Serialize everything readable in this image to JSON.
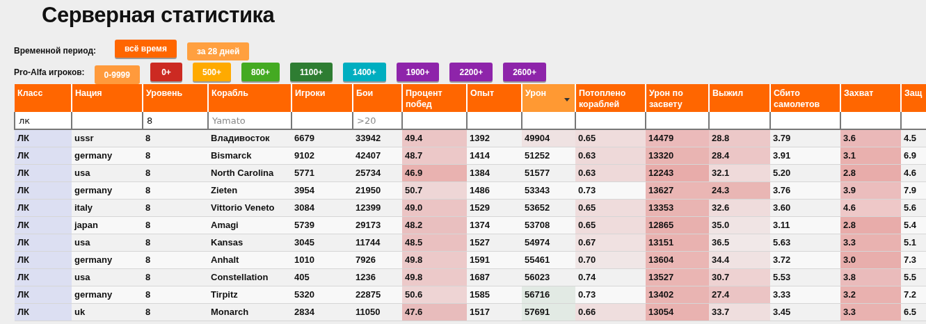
{
  "title": "Серверная статистика",
  "period": {
    "label": "Временной период:",
    "buttons": [
      {
        "label": "всё время",
        "selected": false,
        "color": "#ff6600"
      },
      {
        "label": "за 28 дней",
        "selected": true,
        "color": "#ffa040"
      }
    ]
  },
  "pro_alfa": {
    "label": "Pro-Alfa игроков:",
    "buttons": [
      {
        "label": "0-9999",
        "selected": true,
        "color": "#ff9a3c"
      },
      {
        "label": "0+",
        "selected": false,
        "color": "#cc2a22"
      },
      {
        "label": "500+",
        "selected": false,
        "color": "#ffaa00"
      },
      {
        "label": "800+",
        "selected": false,
        "color": "#44aa22"
      },
      {
        "label": "1100+",
        "selected": false,
        "color": "#2e7d32"
      },
      {
        "label": "1400+",
        "selected": false,
        "color": "#00aec0"
      },
      {
        "label": "1900+",
        "selected": false,
        "color": "#8e24aa"
      },
      {
        "label": "2200+",
        "selected": false,
        "color": "#8e24aa"
      },
      {
        "label": "2600+",
        "selected": false,
        "color": "#8e24aa"
      }
    ]
  },
  "table": {
    "columns": [
      {
        "label": "Класс",
        "sorted": false,
        "filter": {
          "value": "лк"
        }
      },
      {
        "label": "Нация",
        "sorted": false
      },
      {
        "label": "Уровень",
        "sorted": false,
        "filter": {
          "value": "8"
        }
      },
      {
        "label": "Корабль",
        "sorted": false,
        "filter": {
          "placeholder": "Yamato"
        }
      },
      {
        "label": "Игроки",
        "sorted": false
      },
      {
        "label": "Бои",
        "sorted": false,
        "filter": {
          "placeholder": ">20"
        }
      },
      {
        "label": "Процент побед",
        "sorted": false
      },
      {
        "label": "Опыт",
        "sorted": false
      },
      {
        "label": "Урон",
        "sorted": true
      },
      {
        "label": "Потоплено кораблей",
        "sorted": false
      },
      {
        "label": "Урон по засвету",
        "sorted": false
      },
      {
        "label": "Выжил",
        "sorted": false
      },
      {
        "label": "Сбито самолетов",
        "sorted": false
      },
      {
        "label": "Захват",
        "sorted": false
      },
      {
        "label": "Защ",
        "sorted": false
      }
    ],
    "rows": [
      {
        "cells": [
          {
            "text": "ЛК"
          },
          {
            "text": "ussr"
          },
          {
            "text": "8"
          },
          {
            "text": "Владивосток"
          },
          {
            "text": "6679"
          },
          {
            "text": "33942"
          },
          {
            "text": "49.4",
            "color": "#ebc5c5"
          },
          {
            "text": "1392"
          },
          {
            "text": "49904",
            "color": "#efe2e2"
          },
          {
            "text": "0.65",
            "color": "#efdcdc"
          },
          {
            "text": "14479",
            "color": "#ebbaba"
          },
          {
            "text": "28.8",
            "color": "#ecc8c8"
          },
          {
            "text": "3.79"
          },
          {
            "text": "3.6",
            "color": "#eab8b8"
          },
          {
            "text": "4.5"
          }
        ]
      },
      {
        "cells": [
          {
            "text": "ЛК"
          },
          {
            "text": "germany"
          },
          {
            "text": "8"
          },
          {
            "text": "Bismarck"
          },
          {
            "text": "9102"
          },
          {
            "text": "42407"
          },
          {
            "text": "48.7",
            "color": "#ecc8c8"
          },
          {
            "text": "1414"
          },
          {
            "text": "51252"
          },
          {
            "text": "0.63",
            "color": "#eed9d9"
          },
          {
            "text": "13320",
            "color": "#e9b4b2"
          },
          {
            "text": "28.4",
            "color": "#ecc6c6"
          },
          {
            "text": "3.91"
          },
          {
            "text": "3.1",
            "color": "#e9b0ae"
          },
          {
            "text": "6.9"
          }
        ]
      },
      {
        "cells": [
          {
            "text": "ЛК"
          },
          {
            "text": "usa"
          },
          {
            "text": "8"
          },
          {
            "text": "North Carolina"
          },
          {
            "text": "5771"
          },
          {
            "text": "25734"
          },
          {
            "text": "46.9",
            "color": "#e9b2b0"
          },
          {
            "text": "1384"
          },
          {
            "text": "51577"
          },
          {
            "text": "0.63",
            "color": "#eed9d9"
          },
          {
            "text": "12243",
            "color": "#e8acaa"
          },
          {
            "text": "32.1",
            "color": "#efdada"
          },
          {
            "text": "5.20"
          },
          {
            "text": "2.8",
            "color": "#e8acaa"
          },
          {
            "text": "4.6"
          }
        ]
      },
      {
        "cells": [
          {
            "text": "ЛК"
          },
          {
            "text": "germany"
          },
          {
            "text": "8"
          },
          {
            "text": "Zieten"
          },
          {
            "text": "3954"
          },
          {
            "text": "21950"
          },
          {
            "text": "50.7",
            "color": "#eed6d6"
          },
          {
            "text": "1486"
          },
          {
            "text": "53343"
          },
          {
            "text": "0.73"
          },
          {
            "text": "13627",
            "color": "#eab6b4"
          },
          {
            "text": "24.3",
            "color": "#e9b6b4"
          },
          {
            "text": "3.76"
          },
          {
            "text": "3.9",
            "color": "#ebbdbd"
          },
          {
            "text": "7.9"
          }
        ]
      },
      {
        "cells": [
          {
            "text": "ЛК"
          },
          {
            "text": "italy"
          },
          {
            "text": "8"
          },
          {
            "text": "Vittorio Veneto"
          },
          {
            "text": "3084"
          },
          {
            "text": "12399"
          },
          {
            "text": "49.0",
            "color": "#ebc4c4"
          },
          {
            "text": "1529"
          },
          {
            "text": "53652"
          },
          {
            "text": "0.65",
            "color": "#efdcdc"
          },
          {
            "text": "13353",
            "color": "#e9b4b2"
          },
          {
            "text": "32.6",
            "color": "#efdcdc"
          },
          {
            "text": "3.60"
          },
          {
            "text": "4.6",
            "color": "#eec8c8"
          },
          {
            "text": "5.6"
          }
        ]
      },
      {
        "cells": [
          {
            "text": "ЛК"
          },
          {
            "text": "japan"
          },
          {
            "text": "8"
          },
          {
            "text": "Amagi"
          },
          {
            "text": "5739"
          },
          {
            "text": "29173"
          },
          {
            "text": "48.2",
            "color": "#e9bfbf"
          },
          {
            "text": "1374"
          },
          {
            "text": "53708"
          },
          {
            "text": "0.65",
            "color": "#efdcdc"
          },
          {
            "text": "12865",
            "color": "#e8b0ae"
          },
          {
            "text": "35.0",
            "color": "#f0e4e4"
          },
          {
            "text": "3.11"
          },
          {
            "text": "2.8",
            "color": "#e8acaa"
          },
          {
            "text": "5.4"
          }
        ]
      },
      {
        "cells": [
          {
            "text": "ЛК"
          },
          {
            "text": "usa"
          },
          {
            "text": "8"
          },
          {
            "text": "Kansas"
          },
          {
            "text": "3045"
          },
          {
            "text": "11744"
          },
          {
            "text": "48.5",
            "color": "#eac0c0"
          },
          {
            "text": "1527"
          },
          {
            "text": "54974"
          },
          {
            "text": "0.67",
            "color": "#f0e1e1"
          },
          {
            "text": "13151",
            "color": "#e9b2b0"
          },
          {
            "text": "36.5",
            "color": "#f1e8e8"
          },
          {
            "text": "5.63"
          },
          {
            "text": "3.3",
            "color": "#e9b2b0"
          },
          {
            "text": "5.1"
          }
        ]
      },
      {
        "cells": [
          {
            "text": "ЛК"
          },
          {
            "text": "germany"
          },
          {
            "text": "8"
          },
          {
            "text": "Anhalt"
          },
          {
            "text": "1010"
          },
          {
            "text": "7926"
          },
          {
            "text": "49.8",
            "color": "#ecc9c9"
          },
          {
            "text": "1591"
          },
          {
            "text": "55461"
          },
          {
            "text": "0.70",
            "color": "#f0e6e6"
          },
          {
            "text": "13604",
            "color": "#eab6b4"
          },
          {
            "text": "34.4",
            "color": "#f0e2e2"
          },
          {
            "text": "3.72"
          },
          {
            "text": "3.0",
            "color": "#e8aeac"
          },
          {
            "text": "7.3"
          }
        ]
      },
      {
        "cells": [
          {
            "text": "ЛК"
          },
          {
            "text": "usa"
          },
          {
            "text": "8"
          },
          {
            "text": "Constellation"
          },
          {
            "text": "405"
          },
          {
            "text": "1236"
          },
          {
            "text": "49.8",
            "color": "#ecc9c9"
          },
          {
            "text": "1687"
          },
          {
            "text": "56023"
          },
          {
            "text": "0.74"
          },
          {
            "text": "13527",
            "color": "#eab5b3"
          },
          {
            "text": "30.7",
            "color": "#eed2d2"
          },
          {
            "text": "5.53"
          },
          {
            "text": "3.8",
            "color": "#eabbbb"
          },
          {
            "text": "5.5"
          }
        ]
      },
      {
        "cells": [
          {
            "text": "ЛК"
          },
          {
            "text": "germany"
          },
          {
            "text": "8"
          },
          {
            "text": "Tirpitz"
          },
          {
            "text": "5320"
          },
          {
            "text": "22875"
          },
          {
            "text": "50.6",
            "color": "#eed4d4"
          },
          {
            "text": "1585"
          },
          {
            "text": "56716",
            "color": "#e2eae4"
          },
          {
            "text": "0.73"
          },
          {
            "text": "13402",
            "color": "#e9b4b2"
          },
          {
            "text": "27.4",
            "color": "#ebc4c4"
          },
          {
            "text": "3.33"
          },
          {
            "text": "3.2",
            "color": "#e9b1af"
          },
          {
            "text": "7.2"
          }
        ]
      },
      {
        "cells": [
          {
            "text": "ЛК"
          },
          {
            "text": "uk"
          },
          {
            "text": "8"
          },
          {
            "text": "Monarch"
          },
          {
            "text": "2834"
          },
          {
            "text": "11050"
          },
          {
            "text": "47.6",
            "color": "#e8bcbc"
          },
          {
            "text": "1517"
          },
          {
            "text": "57691",
            "color": "#e2eae4"
          },
          {
            "text": "0.66",
            "color": "#efdede"
          },
          {
            "text": "13054",
            "color": "#e9b2b0"
          },
          {
            "text": "33.7",
            "color": "#efdede"
          },
          {
            "text": "3.45"
          },
          {
            "text": "3.3",
            "color": "#e9b2b0"
          },
          {
            "text": "6.5"
          }
        ]
      }
    ]
  }
}
